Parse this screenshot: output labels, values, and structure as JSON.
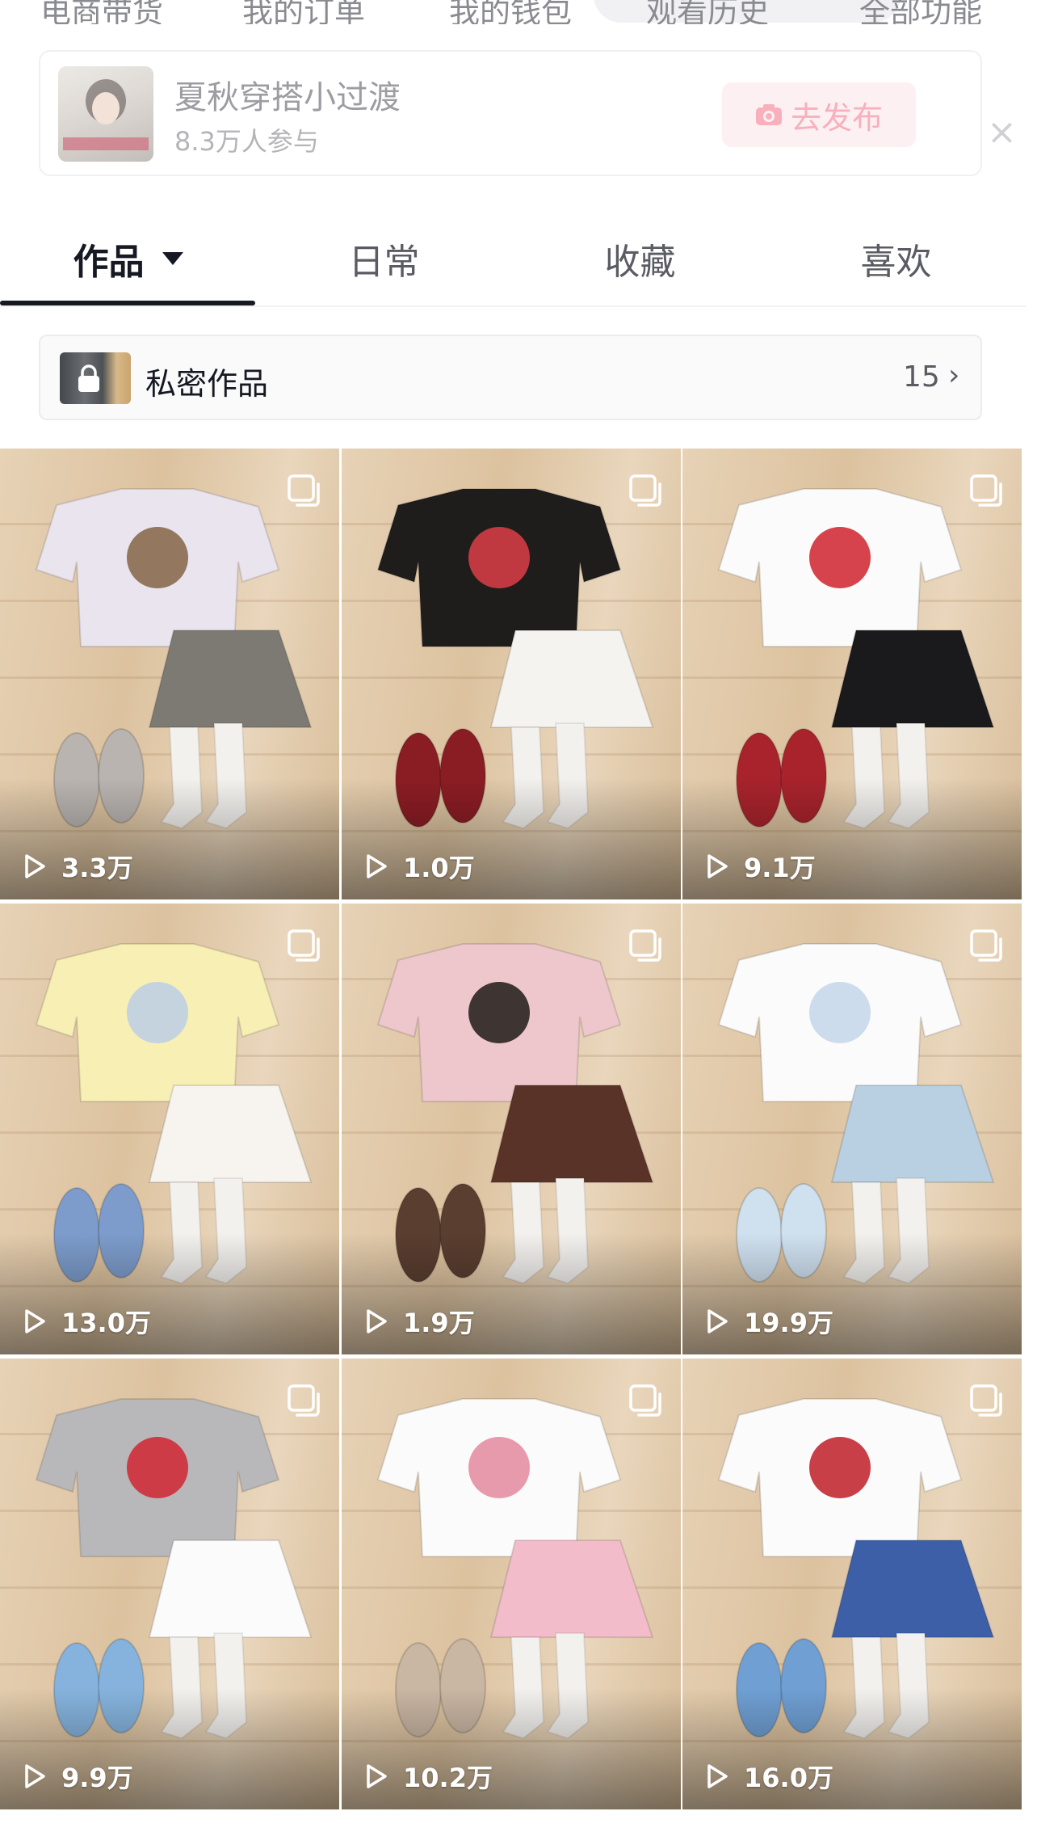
{
  "quick_links": [
    "电商带货",
    "我的订单",
    "我的钱包",
    "观看历史",
    "全部功能"
  ],
  "topic": {
    "title": "夏秋穿搭小过渡",
    "participants": "8.3万人参与",
    "publish_label": "去发布",
    "close_symbol": "×"
  },
  "tabs": [
    {
      "label": "作品",
      "active": true
    },
    {
      "label": "日常",
      "active": false
    },
    {
      "label": "收藏",
      "active": false
    },
    {
      "label": "喜欢",
      "active": false
    }
  ],
  "private_works": {
    "label": "私密作品",
    "count": "15",
    "chevron": "›"
  },
  "posts": [
    {
      "views": "3.3万",
      "top": "#e9e4ee",
      "bottom": "#7d7a74",
      "accent": "#8a6a4e",
      "shoes": "#b9b4b0",
      "socks": "#f3f1ee"
    },
    {
      "views": "1.0万",
      "top": "#1f1c1c",
      "bottom": "#f5f3f0",
      "accent": "#d23d45",
      "shoes": "#8a1d24",
      "socks": "#f3f1ee"
    },
    {
      "views": "9.1万",
      "top": "#fbfbfb",
      "bottom": "#1a1a1c",
      "accent": "#d32f3a",
      "shoes": "#a8232c",
      "socks": "#f3f1ee"
    },
    {
      "views": "13.0万",
      "top": "#f7efb4",
      "bottom": "#f7f3ee",
      "accent": "#bfcfe3",
      "shoes": "#7d9ccb",
      "socks": "#f3f1ee"
    },
    {
      "views": "1.9万",
      "top": "#eec7cd",
      "bottom": "#5a3328",
      "accent": "#2a2522",
      "shoes": "#5a3e30",
      "socks": "#f3f1ee"
    },
    {
      "views": "19.9万",
      "top": "#fbfbfb",
      "bottom": "#b9cfe2",
      "accent": "#c6d8ea",
      "shoes": "#cfe0ef",
      "socks": "#f3f1ee"
    },
    {
      "views": "9.9万",
      "top": "#b8b8ba",
      "bottom": "#fbfbfb",
      "accent": "#cf2f3a",
      "shoes": "#86b3dd",
      "socks": "#f3f1ee"
    },
    {
      "views": "10.2万",
      "top": "#fbfbfb",
      "bottom": "#f2bccb",
      "accent": "#e58fa4",
      "shoes": "#c9b6a3",
      "socks": "#f3f1ee"
    },
    {
      "views": "16.0万",
      "top": "#fbfbfb",
      "bottom": "#3d5fa8",
      "accent": "#c22a34",
      "shoes": "#6f9fd3",
      "socks": "#f3f1ee"
    }
  ]
}
